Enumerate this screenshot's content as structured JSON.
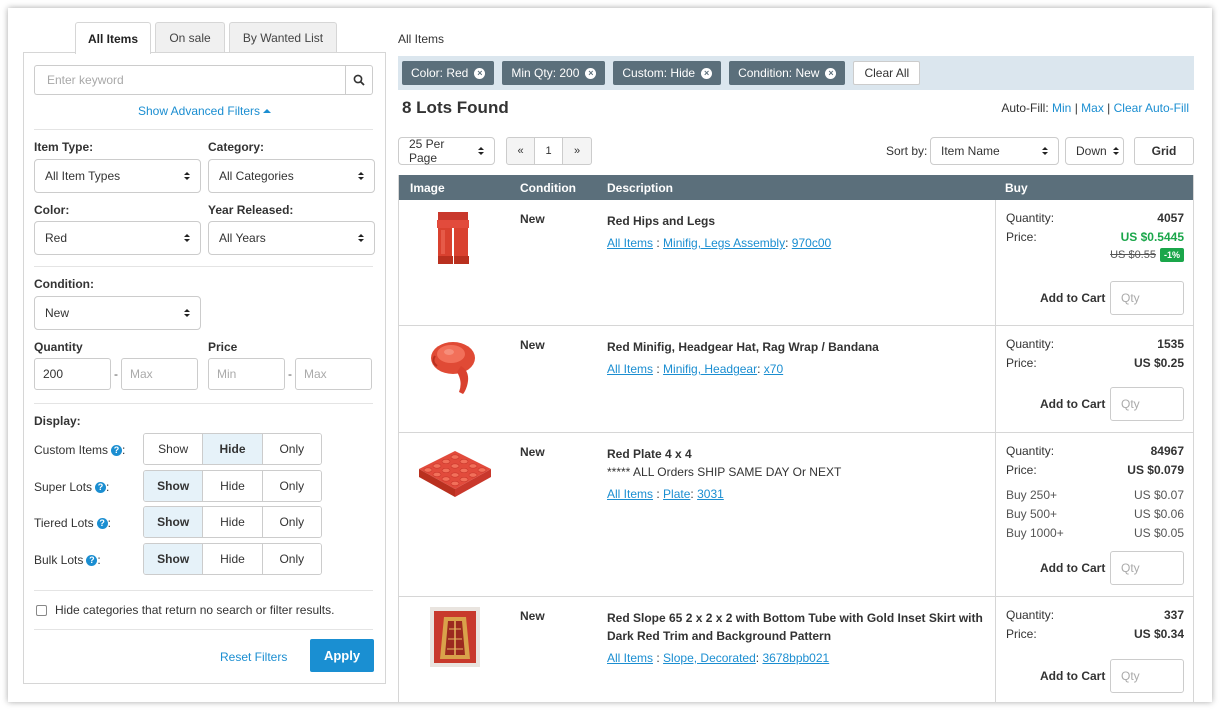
{
  "tabs": [
    "All Items",
    "On sale",
    "By Wanted List"
  ],
  "filters": {
    "search_placeholder": "Enter keyword",
    "advanced_label": "Show Advanced Filters",
    "item_type_label": "Item Type:",
    "item_type_value": "All Item Types",
    "category_label": "Category:",
    "category_value": "All Categories",
    "color_label": "Color:",
    "color_value": "Red",
    "year_label": "Year Released:",
    "year_value": "All Years",
    "condition_label": "Condition:",
    "condition_value": "New",
    "quantity_label": "Quantity",
    "quantity_min": "200",
    "quantity_max_placeholder": "Max",
    "price_label": "Price",
    "price_min_placeholder": "Min",
    "price_max_placeholder": "Max",
    "dash": "-",
    "display_label": "Display:",
    "display_options": [
      "Show",
      "Hide",
      "Only"
    ],
    "display_rows": [
      {
        "label": "Custom Items",
        "selected": "Hide"
      },
      {
        "label": "Super Lots",
        "selected": "Show"
      },
      {
        "label": "Tiered Lots",
        "selected": "Show"
      },
      {
        "label": "Bulk Lots",
        "selected": "Show"
      }
    ],
    "help_glyph": "?",
    "hide_categories_label": "Hide categories that return no search or filter results.",
    "reset_label": "Reset Filters",
    "apply_label": "Apply"
  },
  "breadcrumb": "All Items",
  "chips": [
    "Color: Red",
    "Min Qty: 200",
    "Custom: Hide",
    "Condition: New"
  ],
  "chip_close": "×",
  "clear_all": "Clear All",
  "lots_found": "8 Lots Found",
  "autofill": {
    "label": "Auto-Fill:",
    "min": "Min",
    "sep": "|",
    "max": "Max",
    "clear": "Clear Auto-Fill"
  },
  "toolbar": {
    "per_page": "25 Per Page",
    "pager_prev": "«",
    "pager_page": "1",
    "pager_next": "»",
    "sort_label": "Sort by:",
    "sort_value": "Item Name",
    "direction_value": "Down",
    "grid_label": "Grid"
  },
  "table": {
    "headers": [
      "Image",
      "Condition",
      "Description",
      "Buy"
    ],
    "quantity_label": "Quantity:",
    "price_label": "Price:",
    "add_to_cart": "Add to Cart",
    "qty_placeholder": "Qty",
    "link_sep": ":",
    "rows": [
      {
        "condition": "New",
        "name": "Red Hips and Legs",
        "note": "",
        "links": [
          "All Items",
          "Minifig, Legs Assembly",
          "970c00"
        ],
        "quantity": "4057",
        "price": "US $0.5445",
        "orig_price": "US $0.55",
        "discount": "-1%",
        "tiers": []
      },
      {
        "condition": "New",
        "name": "Red Minifig, Headgear Hat, Rag Wrap / Bandana",
        "note": "",
        "links": [
          "All Items",
          "Minifig, Headgear",
          "x70"
        ],
        "quantity": "1535",
        "price": "US $0.25",
        "tiers": []
      },
      {
        "condition": "New",
        "name": "Red Plate 4 x 4",
        "note": "***** ALL Orders SHIP SAME DAY Or NEXT",
        "links": [
          "All Items",
          "Plate",
          "3031"
        ],
        "quantity": "84967",
        "price": "US $0.079",
        "tiers": [
          {
            "label": "Buy 250+",
            "price": "US $0.07"
          },
          {
            "label": "Buy 500+",
            "price": "US $0.06"
          },
          {
            "label": "Buy 1000+",
            "price": "US $0.05"
          }
        ]
      },
      {
        "condition": "New",
        "name": "Red Slope 65 2 x 2 x 2 with Bottom Tube with Gold Inset Skirt with Dark Red Trim and Background Pattern",
        "note": "",
        "links": [
          "All Items",
          "Slope, Decorated",
          "3678bpb021"
        ],
        "quantity": "337",
        "price": "US $0.34",
        "tiers": []
      }
    ]
  },
  "colors": {
    "accent": "#1b8ed1",
    "header": "#5b6f7b",
    "sale_green": "#1aa64a",
    "chip_bar": "#dbe6ee"
  }
}
